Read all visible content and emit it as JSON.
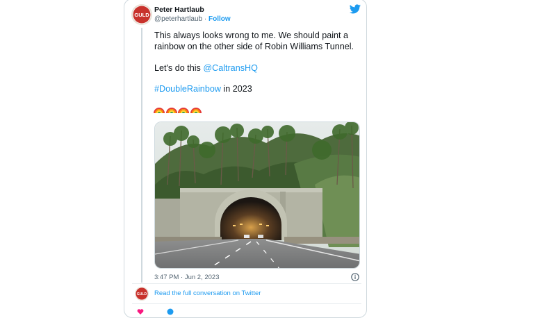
{
  "tweet": {
    "author_name": "Peter Hartlaub",
    "handle": "@peterhartlaub",
    "separator": " · ",
    "follow_label": "Follow",
    "avatar_text": "GULD",
    "text_line1": "This always looks wrong to me. We should paint a",
    "text_line2": "rainbow on the other side of Robin Williams Tunnel.",
    "lets_prefix": "Let's do this ",
    "mention": "@CaltransHQ",
    "hashtag": "#DoubleRainbow",
    "hashtag_suffix": " in 2023",
    "emoji": [
      "rainbow",
      "rainbow",
      "rainbow",
      "rainbow"
    ],
    "timestamp": "3:47 PM · Jun 2, 2023",
    "read_more": "Read the full conversation on Twitter"
  },
  "colors": {
    "link": "#1d9bf0",
    "text": "#0f1419",
    "muted": "#536471",
    "border": "#cfd9de"
  },
  "icons": {
    "brand": "twitter-bird-icon",
    "info": "info-icon",
    "like": "heart-icon",
    "reply": "reply-icon"
  }
}
